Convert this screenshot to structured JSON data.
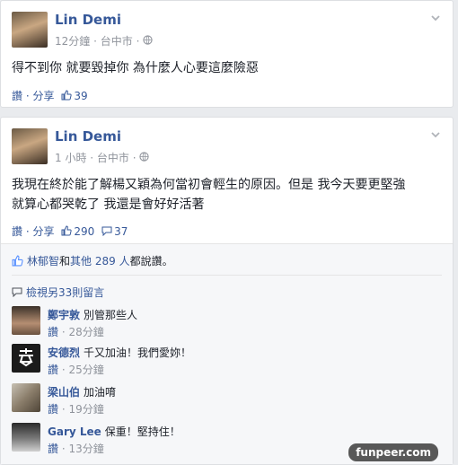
{
  "post1": {
    "author": "Lin Demi",
    "time": "12分鐘",
    "location": "台中市",
    "text": "得不到你 就要毀掉你 為什麼人心要這麼險惡",
    "like_label": "讚",
    "share_label": "分享",
    "like_count": "39"
  },
  "post2": {
    "author": "Lin Demi",
    "time": "1 小時",
    "location": "台中市",
    "text_line1": "我現在終於能了解楊又穎為何當初會輕生的原因。但是 我今天要更堅強",
    "text_line2": "就算心都哭乾了 我還是會好好活著",
    "like_label": "讚",
    "share_label": "分享",
    "like_count": "290",
    "comment_count": "37",
    "likers_names": "林郁智",
    "likers_mid": "和",
    "likers_others": "其他 289 人",
    "likers_tail": "都說讚。",
    "view_more": "檢視另33則留言",
    "comments": [
      {
        "name": "鄭宇敦",
        "text": "別管那些人",
        "like": "讚",
        "time": "28分鐘"
      },
      {
        "name": "安德烈",
        "text": "千又加油！我們愛妳！",
        "like": "讚",
        "time": "25分鐘"
      },
      {
        "name": "梁山伯",
        "text": "加油唷",
        "like": "讚",
        "time": "19分鐘"
      },
      {
        "name": "Gary Lee",
        "text": "保重！堅持住！",
        "like": "讚",
        "time": "13分鐘"
      }
    ]
  },
  "watermark": "funpeer.com"
}
